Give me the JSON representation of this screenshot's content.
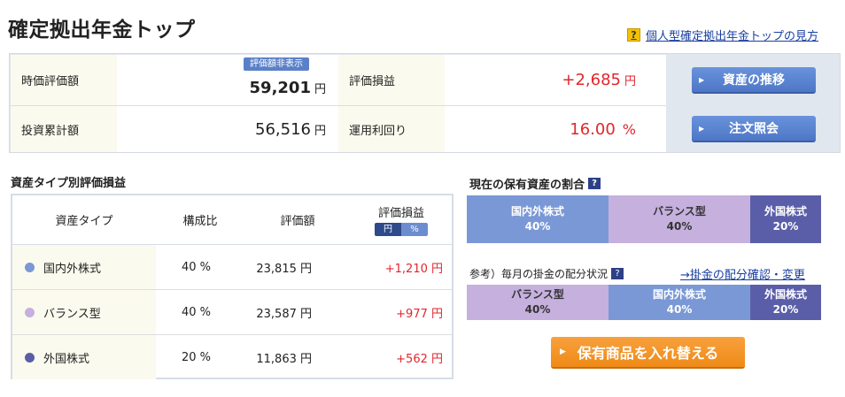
{
  "page_title": "確定拠出年金トップ",
  "guide_link": {
    "icon": "?",
    "label": "個人型確定拠出年金トップの見方"
  },
  "summary": {
    "market_value_label": "時価評価額",
    "market_value": "59,201",
    "hide_badge": "評価額非表示",
    "profit_label": "評価損益",
    "profit_value": "+2,685",
    "invested_label": "投資累計額",
    "invested_value": "56,516",
    "yield_label": "運用利回り",
    "yield_value": "16.00",
    "yield_unit": "%",
    "yen": "円",
    "btn_asset_trend": "資産の推移",
    "btn_orders": "注文照会"
  },
  "asset_table": {
    "heading": "資産タイプ別評価損益",
    "columns": [
      "資産タイプ",
      "構成比",
      "評価額",
      "評価損益"
    ],
    "toggle": [
      "円",
      "%"
    ],
    "rows": [
      {
        "name": "国内外株式",
        "ratio": "40 %",
        "value": "23,815 円",
        "pl": "+1,210 円",
        "color": "#7a98d6"
      },
      {
        "name": "バランス型",
        "ratio": "40 %",
        "value": "23,587 円",
        "pl": "+977 円",
        "color": "#c5b0de"
      },
      {
        "name": "外国株式",
        "ratio": "20 %",
        "value": "11,863 円",
        "pl": "+562 円",
        "color": "#5a5ea8"
      }
    ]
  },
  "current_alloc": {
    "heading": "現在の保有資産の割合",
    "help": "?",
    "segments": [
      {
        "name": "国内外株式",
        "pct": "40%"
      },
      {
        "name": "バランス型",
        "pct": "40%"
      },
      {
        "name": "外国株式",
        "pct": "20%"
      }
    ]
  },
  "monthly_alloc": {
    "heading": "参考）毎月の掛金の配分状況",
    "help": "?",
    "link": "→掛金の配分確認・変更",
    "segments": [
      {
        "name": "バランス型",
        "pct": "40%"
      },
      {
        "name": "国内外株式",
        "pct": "40%"
      },
      {
        "name": "外国株式",
        "pct": "20%"
      }
    ]
  },
  "switch_button": "保有商品を入れ替える",
  "colors": {
    "domestic": "#7a98d6",
    "balance": "#c5b0de",
    "foreign": "#5a5ea8",
    "accent_red": "#e2262c",
    "orange": "#f39a2b"
  }
}
